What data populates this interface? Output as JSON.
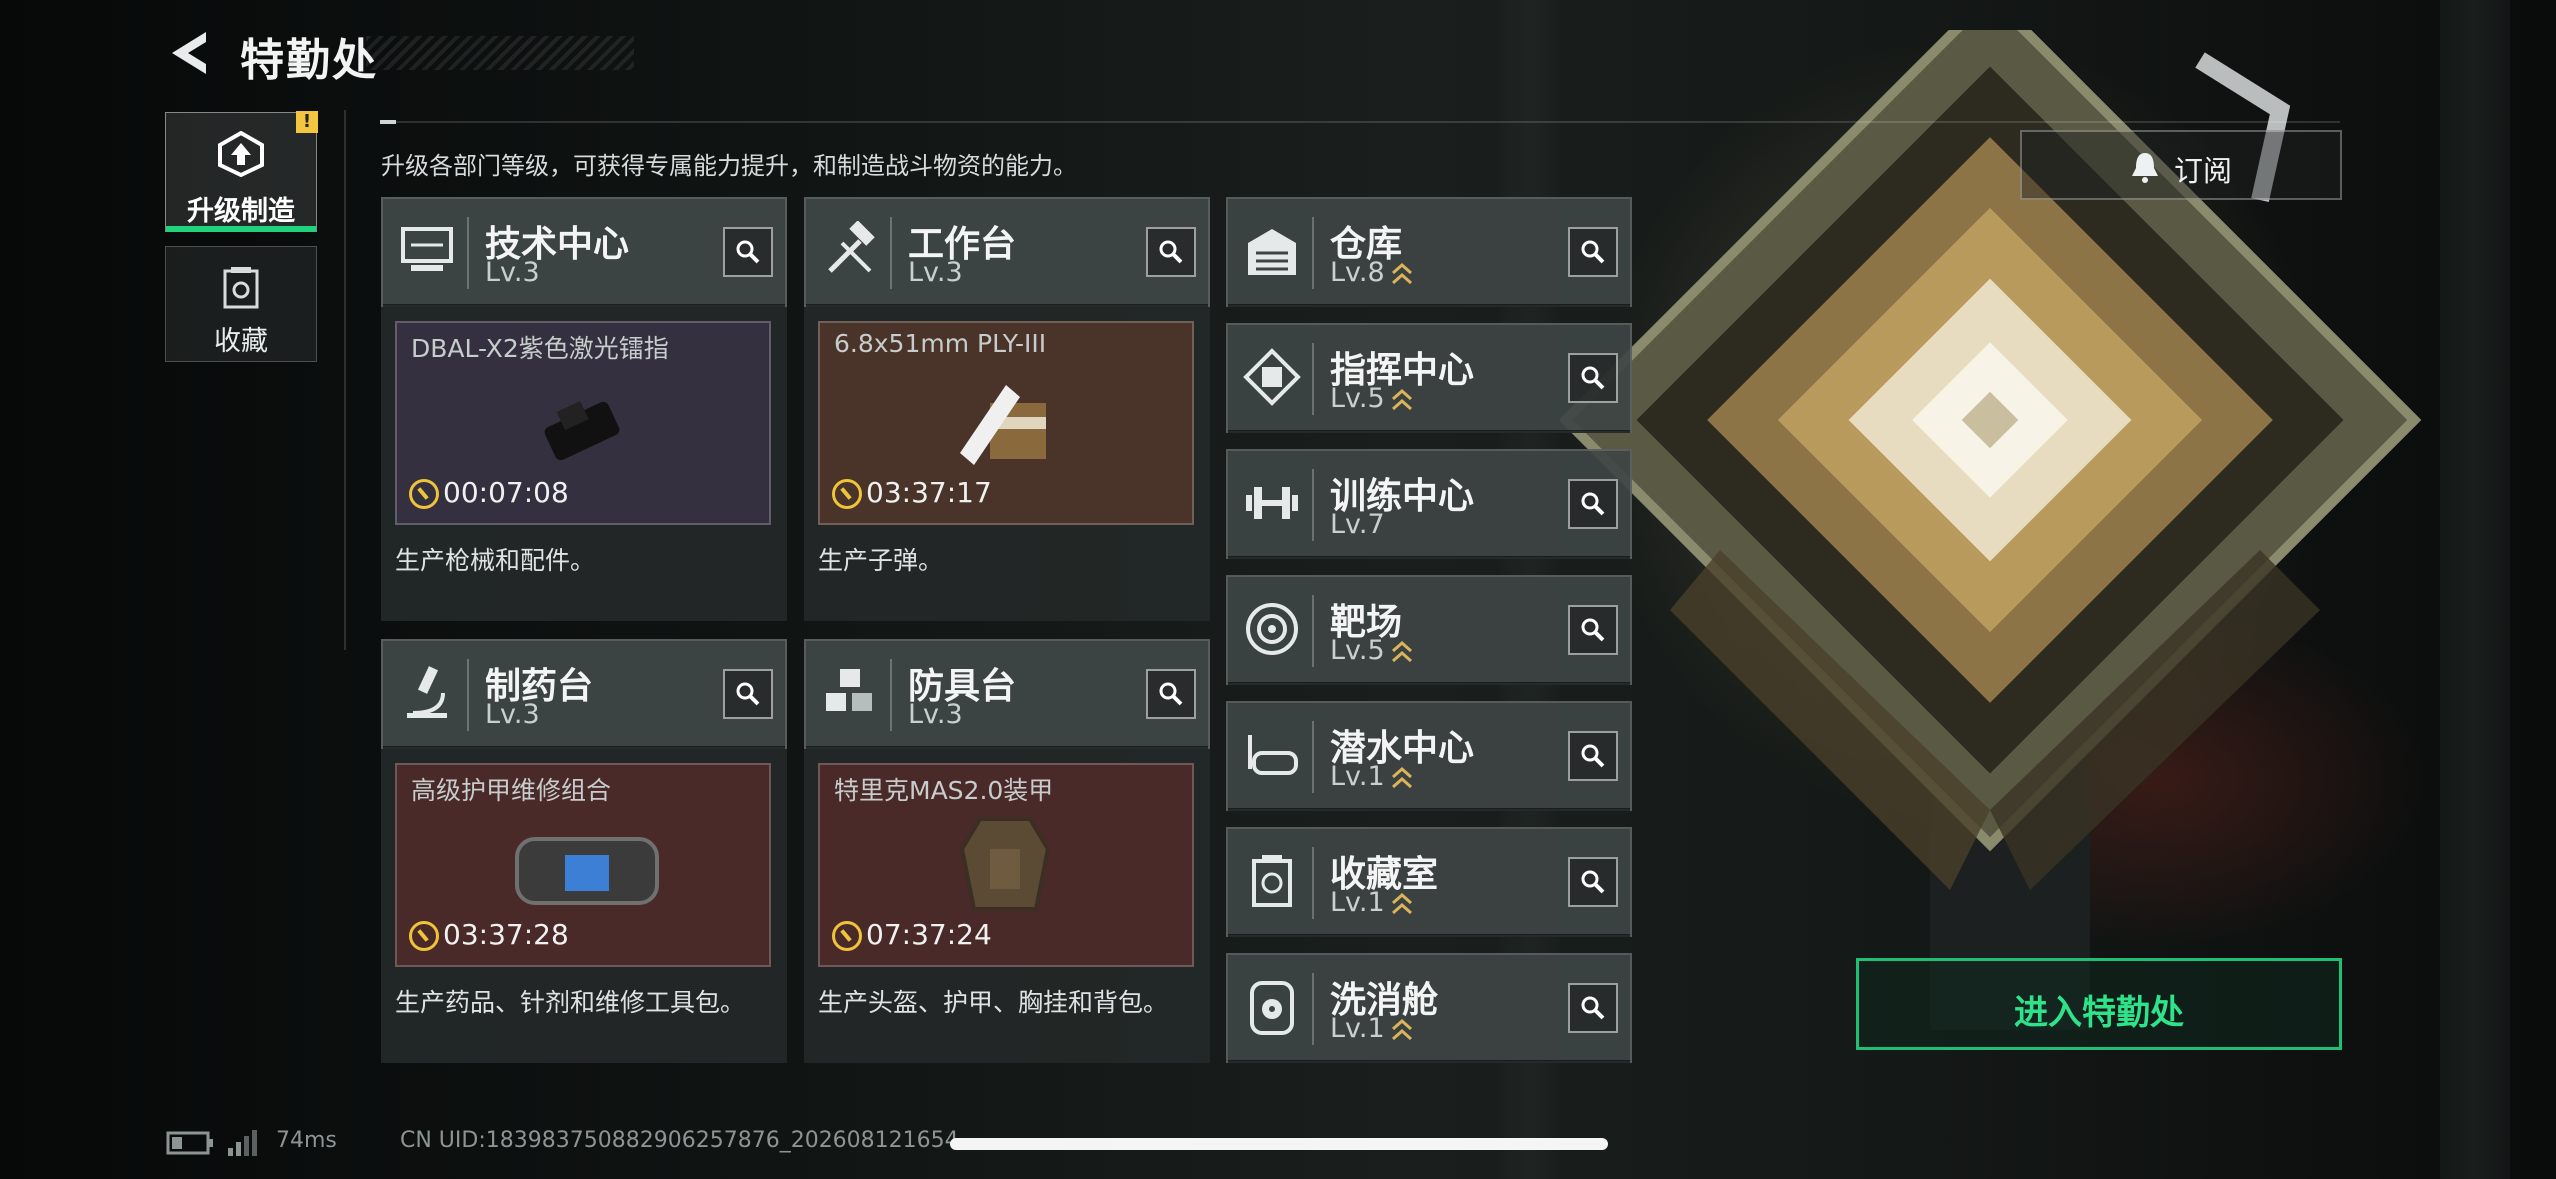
{
  "header": {
    "title": "特勤处"
  },
  "sidebar": {
    "items": [
      {
        "label": "升级制造",
        "active": true,
        "alert": "!"
      },
      {
        "label": "收藏",
        "active": false
      }
    ]
  },
  "description": "升级各部门等级，可获得专属能力提升，和制造战斗物资的能力。",
  "departments": [
    {
      "name": "技术中心",
      "level": "Lv.3",
      "item": "DBAL-X2紫色激光镭指",
      "timer": "00:07:08",
      "desc": "生产枪械和配件。",
      "icon": "monitor-icon",
      "item_color": "#35303f"
    },
    {
      "name": "工作台",
      "level": "Lv.3",
      "item": "6.8x51mm PLY-III",
      "timer": "03:37:17",
      "desc": "生产子弹。",
      "icon": "hammer-wrench-icon",
      "item_color": "#4a3429"
    },
    {
      "name": "制药台",
      "level": "Lv.3",
      "item": "高级护甲维修组合",
      "timer": "03:37:28",
      "desc": "生产药品、针剂和维修工具包。",
      "icon": "microscope-icon",
      "item_color": "#4a2a29"
    },
    {
      "name": "防具台",
      "level": "Lv.3",
      "item": "特里克MAS2.0装甲",
      "timer": "07:37:24",
      "desc": "生产头盔、护甲、胸挂和背包。",
      "icon": "armor-blocks-icon",
      "item_color": "#4a2a29"
    }
  ],
  "facilities": [
    {
      "name": "仓库",
      "level": "Lv.8",
      "upgradable": true,
      "icon": "garage-icon"
    },
    {
      "name": "指挥中心",
      "level": "Lv.5",
      "upgradable": true,
      "icon": "command-chip-icon"
    },
    {
      "name": "训练中心",
      "level": "Lv.7",
      "upgradable": false,
      "icon": "dumbbell-icon"
    },
    {
      "name": "靶场",
      "level": "Lv.5",
      "upgradable": true,
      "icon": "target-icon"
    },
    {
      "name": "潜水中心",
      "level": "Lv.1",
      "upgradable": true,
      "icon": "diving-mask-icon"
    },
    {
      "name": "收藏室",
      "level": "Lv.1",
      "upgradable": true,
      "icon": "collection-icon"
    },
    {
      "name": "洗消舱",
      "level": "Lv.1",
      "upgradable": true,
      "icon": "radiation-icon"
    }
  ],
  "subscribe": {
    "label": "订阅"
  },
  "enter": {
    "label": "进入特勤处"
  },
  "status": {
    "latency": "74ms",
    "uid": "CN UID:18398375088290625787​6_20260812​1654"
  },
  "colors": {
    "accent_green": "#1fd37d",
    "timer_yellow": "#f0c43a",
    "upgrade_chevron": "#d9b45a"
  }
}
